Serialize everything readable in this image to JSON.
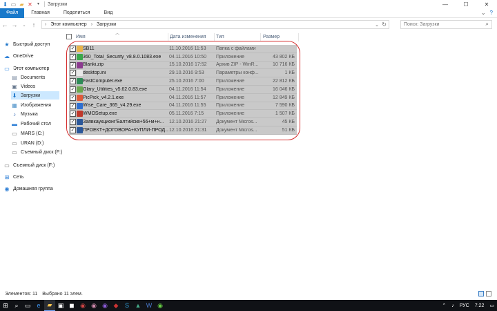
{
  "window": {
    "title": "Загрузки",
    "controls": [
      "—",
      "☐",
      "✕"
    ]
  },
  "ribbon": {
    "tabs": [
      "Файл",
      "Главная",
      "Поделиться",
      "Вид"
    ]
  },
  "address": {
    "crumbs": [
      "Этот компьютер",
      "Загрузки"
    ],
    "search_placeholder": "Поиск: Загрузки"
  },
  "sidebar": {
    "items": [
      {
        "label": "Быстрый доступ",
        "icon": "star-icon"
      },
      {
        "label": "OneDrive",
        "icon": "cloud-icon"
      },
      {
        "label": "Этот компьютер",
        "icon": "computer-icon"
      },
      {
        "label": "Documents",
        "icon": "documents-icon"
      },
      {
        "label": "Videos",
        "icon": "video-icon"
      },
      {
        "label": "Загрузки",
        "icon": "downloads-icon"
      },
      {
        "label": "Изображения",
        "icon": "pictures-icon"
      },
      {
        "label": "Музыка",
        "icon": "music-icon"
      },
      {
        "label": "Рабочий стол",
        "icon": "desktop-icon"
      },
      {
        "label": "MARS (C:)",
        "icon": "drive-icon"
      },
      {
        "label": "URAN (D:)",
        "icon": "drive-icon"
      },
      {
        "label": "Съемный диск (F:)",
        "icon": "usb-drive-icon"
      },
      {
        "label": "Съемный диск (F:)",
        "icon": "usb-drive-icon"
      },
      {
        "label": "Сеть",
        "icon": "network-icon"
      },
      {
        "label": "Домашняя группа",
        "icon": "homegroup-icon"
      }
    ]
  },
  "columns": {
    "name": "Имя",
    "date": "Дата изменения",
    "type": "Тип",
    "size": "Размер"
  },
  "files": [
    {
      "name": "SB11",
      "date": "11.10.2016 11:53",
      "type": "Папка с файлами",
      "size": "",
      "icon_color": "#e8b34a"
    },
    {
      "name": "360_Total_Security_v8.8.0.1083.exe",
      "date": "04.11.2016 10:50",
      "type": "Приложение",
      "size": "43 802 КБ",
      "icon_color": "#3aa84b"
    },
    {
      "name": "Blanki.zip",
      "date": "15.10.2016 17:52",
      "type": "Архив ZIP - WinR...",
      "size": "10 716 КБ",
      "icon_color": "#8b3a8f"
    },
    {
      "name": "desktop.ini",
      "date": "29.10.2016 9:53",
      "type": "Параметры конф...",
      "size": "1 КБ",
      "icon_color": "#e8e8e8"
    },
    {
      "name": "FastComputer.exe",
      "date": "25.10.2016 7:00",
      "type": "Приложение",
      "size": "22 812 КБ",
      "icon_color": "#2e8b57"
    },
    {
      "name": "Glary_Utilities_v5.62.0.83.exe",
      "date": "04.11.2016 11:54",
      "type": "Приложение",
      "size": "16 046 КБ",
      "icon_color": "#6aa84f"
    },
    {
      "name": "PicPick_v4.2.1.exe",
      "date": "04.11.2016 11:57",
      "type": "Приложение",
      "size": "12 849 КБ",
      "icon_color": "#e05a3a"
    },
    {
      "name": "Wise_Care_365_v4.29.exe",
      "date": "04.11.2016 11:55",
      "type": "Приложение",
      "size": "7 590 КБ",
      "icon_color": "#2f6fd0"
    },
    {
      "name": "WMOSetup.exe",
      "date": "05.11.2016 7:15",
      "type": "Приложение",
      "size": "1 507 КБ",
      "icon_color": "#c0392b"
    },
    {
      "name": "Заявкаукционг'Балтийскв+56+м+н...",
      "date": "12.10.2016 21:27",
      "type": "Документ Micros...",
      "size": "45 КБ",
      "icon_color": "#2b579a"
    },
    {
      "name": "ПРОЕКТ+ДОГОВОРА+КУПЛИ-ПРОД...",
      "date": "12.10.2016 21:31",
      "type": "Документ Micros...",
      "size": "51 КБ",
      "icon_color": "#2b579a"
    }
  ],
  "status": {
    "count": "Элементов: 11",
    "selected": "Выбрано 11 элем."
  },
  "taskbar": {
    "lang": "РУС",
    "time": "7:22"
  }
}
